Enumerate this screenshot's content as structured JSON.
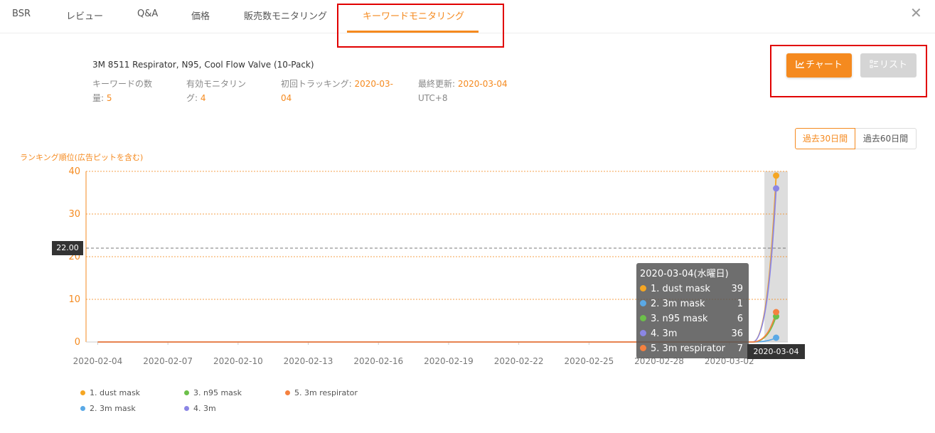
{
  "tabs": [
    {
      "label": "BSR"
    },
    {
      "label": "レビュー"
    },
    {
      "label": "Q&A"
    },
    {
      "label": "価格"
    },
    {
      "label": "販売数モニタリング"
    },
    {
      "label": "キーワードモニタリング",
      "active": true
    }
  ],
  "close_icon": "close-icon",
  "product": {
    "title": "3M 8511 Respirator, N95, Cool Flow Valve (10-Pack)",
    "keyword_count_label": "キーワードの数量:",
    "keyword_count": "5",
    "active_monitoring_label": "有効モニタリング:",
    "active_monitoring": "4",
    "first_tracking_label": "初回トラッキング:",
    "first_tracking": "2020-03-04",
    "last_update_label": "最終更新:",
    "last_update": "2020-03-04",
    "timezone": "UTC+8"
  },
  "view_buttons": {
    "chart_label": "チャート",
    "chart_icon": "line-chart-icon",
    "list_label": "リスト",
    "list_icon": "list-icon"
  },
  "period_buttons": {
    "last30": "過去30日間",
    "last60": "過去60日間",
    "selected": "last30"
  },
  "colors": {
    "accent": "#f58a1f",
    "series": [
      "#f5a623",
      "#5aa9e6",
      "#6cc04a",
      "#8b86e5",
      "#f5813f"
    ]
  },
  "chart_data": {
    "type": "line",
    "ylabel": "ランキング順位(広告ピットを含む)",
    "ylim": [
      0,
      40
    ],
    "yticks": [
      0,
      10,
      20,
      30,
      40
    ],
    "xticks": [
      "2020-02-04",
      "2020-02-07",
      "2020-02-10",
      "2020-02-13",
      "2020-02-16",
      "2020-02-19",
      "2020-02-22",
      "2020-02-25",
      "2020-02-28",
      "2020-03-02"
    ],
    "x": [
      "2020-02-04",
      "2020-02-05",
      "2020-02-06",
      "2020-02-07",
      "2020-02-08",
      "2020-02-09",
      "2020-02-10",
      "2020-02-11",
      "2020-02-12",
      "2020-02-13",
      "2020-02-14",
      "2020-02-15",
      "2020-02-16",
      "2020-02-17",
      "2020-02-18",
      "2020-02-19",
      "2020-02-20",
      "2020-02-21",
      "2020-02-22",
      "2020-02-23",
      "2020-02-24",
      "2020-02-25",
      "2020-02-26",
      "2020-02-27",
      "2020-02-28",
      "2020-02-29",
      "2020-03-01",
      "2020-03-02",
      "2020-03-03",
      "2020-03-04"
    ],
    "series": [
      {
        "name": "1. dust mask",
        "values": [
          0,
          0,
          0,
          0,
          0,
          0,
          0,
          0,
          0,
          0,
          0,
          0,
          0,
          0,
          0,
          0,
          0,
          0,
          0,
          0,
          0,
          0,
          0,
          0,
          0,
          0,
          0,
          0,
          0,
          39
        ]
      },
      {
        "name": "2. 3m mask",
        "values": [
          0,
          0,
          0,
          0,
          0,
          0,
          0,
          0,
          0,
          0,
          0,
          0,
          0,
          0,
          0,
          0,
          0,
          0,
          0,
          0,
          0,
          0,
          0,
          0,
          0,
          0,
          0,
          0,
          0,
          1
        ]
      },
      {
        "name": "3. n95 mask",
        "values": [
          0,
          0,
          0,
          0,
          0,
          0,
          0,
          0,
          0,
          0,
          0,
          0,
          0,
          0,
          0,
          0,
          0,
          0,
          0,
          0,
          0,
          0,
          0,
          0,
          0,
          0,
          0,
          0,
          0,
          6
        ]
      },
      {
        "name": "4. 3m",
        "values": [
          0,
          0,
          0,
          0,
          0,
          0,
          0,
          0,
          0,
          0,
          0,
          0,
          0,
          0,
          0,
          0,
          0,
          0,
          0,
          0,
          0,
          0,
          0,
          0,
          0,
          0,
          0,
          0,
          0,
          36
        ]
      },
      {
        "name": "5. 3m respirator",
        "values": [
          0,
          0,
          0,
          0,
          0,
          0,
          0,
          0,
          0,
          0,
          0,
          0,
          0,
          0,
          0,
          0,
          0,
          0,
          0,
          0,
          0,
          0,
          0,
          0,
          0,
          0,
          0,
          0,
          0,
          7
        ]
      }
    ],
    "hover_date": "2020-03-04",
    "crosshair_y": "22.00",
    "grid": true,
    "legend_position": "bottom-left"
  },
  "tooltip": {
    "title": "2020-03-04(水曜日)",
    "rows": [
      {
        "name": "1. dust mask",
        "value": "39"
      },
      {
        "name": "2. 3m mask",
        "value": "1"
      },
      {
        "name": "3. n95 mask",
        "value": "6"
      },
      {
        "name": "4. 3m",
        "value": "36"
      },
      {
        "name": "5. 3m respirator",
        "value": "7"
      }
    ]
  },
  "axis_pointer": {
    "y_label": "22.00",
    "x_label": "2020-03-04"
  }
}
